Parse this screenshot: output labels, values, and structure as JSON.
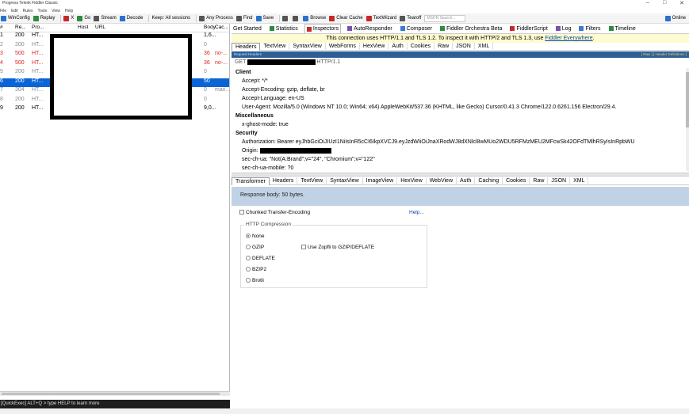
{
  "window": {
    "title": "Progress Telerik Fiddler Classic",
    "controls": [
      "–",
      "□",
      "✕"
    ]
  },
  "menu": [
    "File",
    "Edit",
    "Rules",
    "Tools",
    "View",
    "Help"
  ],
  "toolbar": {
    "items": [
      {
        "label": "WinConfig",
        "icon": "windows-icon",
        "color": "#2a72c9"
      },
      {
        "label": "Replay",
        "icon": "replay-icon",
        "color": "#2e8b3d"
      },
      {
        "label": "X",
        "icon": "remove-icon",
        "color": "#c62828"
      },
      {
        "label": "Go",
        "icon": "go-icon",
        "color": "#2e8b3d"
      },
      {
        "label": "Stream",
        "icon": "stream-icon",
        "color": "#555555"
      },
      {
        "label": "Decode",
        "icon": "decode-icon",
        "color": "#2a72c9"
      },
      {
        "label": "Keep: All sessions",
        "icon": "",
        "color": ""
      },
      {
        "label": "Any Process",
        "icon": "crosshair-icon",
        "color": "#555555"
      },
      {
        "label": "Find",
        "icon": "binoculars-icon",
        "color": "#555555"
      },
      {
        "label": "Save",
        "icon": "save-icon",
        "color": "#2a72c9"
      },
      {
        "label": "",
        "icon": "camera-icon",
        "color": "#555555"
      },
      {
        "label": "",
        "icon": "timer-icon",
        "color": "#555555"
      },
      {
        "label": "Browse",
        "icon": "globe-icon",
        "color": "#2a72c9"
      },
      {
        "label": "Clear Cache",
        "icon": "clear-cache-icon",
        "color": "#c62828"
      },
      {
        "label": "TextWizard",
        "icon": "textwizard-icon",
        "color": "#c62828"
      },
      {
        "label": "Tearoff",
        "icon": "tearoff-icon",
        "color": "#555555"
      }
    ],
    "search_placeholder": "MSDN Search...",
    "online_label": "Online"
  },
  "sessions": {
    "columns": [
      "#",
      "Re...",
      "Pro...",
      "Host",
      "URL",
      "Body",
      "Cac..."
    ],
    "rows": [
      {
        "num": "1",
        "result": "200",
        "proto": "HT...",
        "body": "1,6...",
        "cache": "",
        "state": "normal"
      },
      {
        "num": "2",
        "result": "200",
        "proto": "HT...",
        "body": "0",
        "cache": "",
        "state": "dim"
      },
      {
        "num": "3",
        "result": "500",
        "proto": "HT...",
        "body": "36",
        "cache": "no-...",
        "state": "error"
      },
      {
        "num": "4",
        "result": "500",
        "proto": "HT...",
        "body": "36",
        "cache": "no-...",
        "state": "error"
      },
      {
        "num": "5",
        "result": "200",
        "proto": "HT...",
        "body": "0",
        "cache": "",
        "state": "dim"
      },
      {
        "num": "6",
        "result": "200",
        "proto": "HT...",
        "body": "50",
        "cache": "",
        "state": "selected"
      },
      {
        "num": "7",
        "result": "304",
        "proto": "HT...",
        "body": "0",
        "cache": "max...",
        "state": "dim"
      },
      {
        "num": "8",
        "result": "200",
        "proto": "HT...",
        "body": "0",
        "cache": "",
        "state": "dim"
      },
      {
        "num": "9",
        "result": "200",
        "proto": "HT...",
        "body": "9,0...",
        "cache": "",
        "state": "normal"
      }
    ]
  },
  "quickexec": "[QuickExec] ALT+Q > type HELP to learn more",
  "statusbar": "",
  "toptabs": [
    {
      "label": "Get Started",
      "icon": "",
      "active": false
    },
    {
      "label": "Statistics",
      "icon": "statistics-icon",
      "active": false
    },
    {
      "label": "Inspectors",
      "icon": "inspectors-icon",
      "active": true
    },
    {
      "label": "AutoResponder",
      "icon": "autoresponder-icon",
      "active": false
    },
    {
      "label": "Composer",
      "icon": "composer-icon",
      "active": false
    },
    {
      "label": "Fiddler Orchestra Beta",
      "icon": "orchestra-icon",
      "active": false
    },
    {
      "label": "FiddlerScript",
      "icon": "script-icon",
      "active": false
    },
    {
      "label": "Log",
      "icon": "log-icon",
      "active": false
    },
    {
      "label": "Filters",
      "icon": "filters-icon",
      "active": false
    },
    {
      "label": "Timeline",
      "icon": "timeline-icon",
      "active": false
    }
  ],
  "banner": {
    "text": "This connection uses HTTP/1.1 and TLS 1.2. To inspect it with HTTP/2 and TLS 1.3, use ",
    "link": "Fiddler Everywhere",
    "end": "."
  },
  "request_tabs": [
    "Headers",
    "TextView",
    "SyntaxView",
    "WebForms",
    "HexView",
    "Auth",
    "Cookies",
    "Raw",
    "JSON",
    "XML"
  ],
  "request_headers_bar": {
    "title": "Request Headers",
    "right": "[ Raw ]    [ Header Definitions ]"
  },
  "request_line": {
    "method": "GET",
    "version": "HTTP/1.1"
  },
  "header_sections": [
    {
      "name": "Client",
      "lines": [
        "Accept: */*",
        "Accept-Encoding: gzip, deflate, br",
        "Accept-Language: en-US",
        "User-Agent: Mozilla/5.0 (Windows NT 10.0; Win64; x64) AppleWebKit/537.36 (KHTML, like Gecko) Cursor/0.41.3 Chrome/122.0.6261.156 Electron/29.4."
      ]
    },
    {
      "name": "Miscellaneous",
      "lines": [
        "x-ghost-mode: true"
      ]
    },
    {
      "name": "Security",
      "lines": [
        "Authorization: Bearer eyJhbGciOiJIUzI1NiIsInR5cCI6IkpXVCJ9.eyJzdWIiOiJnaXRodWJ8dXNlcl8wMUo2WDU5RFMzMEU2MFcwSk42OFdTMlhRSyIsInRpbWU",
        "Origin:",
        "sec-ch-ua: \"Not(A:Brand\";v=\"24\", \"Chromium\";v=\"122\"",
        "sec-ch-ua-mobile: ?0"
      ]
    }
  ],
  "response_tabs": [
    "Transformer",
    "Headers",
    "TextView",
    "SyntaxView",
    "ImageView",
    "HexView",
    "WebView",
    "Auth",
    "Caching",
    "Cookies",
    "Raw",
    "JSON",
    "XML"
  ],
  "response_bar": "Response body: 50 bytes.",
  "transformer": {
    "chunked_label": "Chunked Transfer-Encoding",
    "help_link": "Help...",
    "compression_legend": "HTTP Compression",
    "options": [
      {
        "label": "None",
        "selected": true
      },
      {
        "label": "GZIP",
        "selected": false
      },
      {
        "label": "DEFLATE",
        "selected": false
      },
      {
        "label": "BZIP2",
        "selected": false
      },
      {
        "label": "Brotli",
        "selected": false
      }
    ],
    "zopfli_label": "Use Zopfli to GZIP/DEFLATE"
  },
  "colors": {
    "selected_row": "#0a64d6",
    "error_text": "#e02020",
    "dim_text": "#888888",
    "response_bar": "#c1d2e6",
    "banner": "#fdfbd0"
  }
}
